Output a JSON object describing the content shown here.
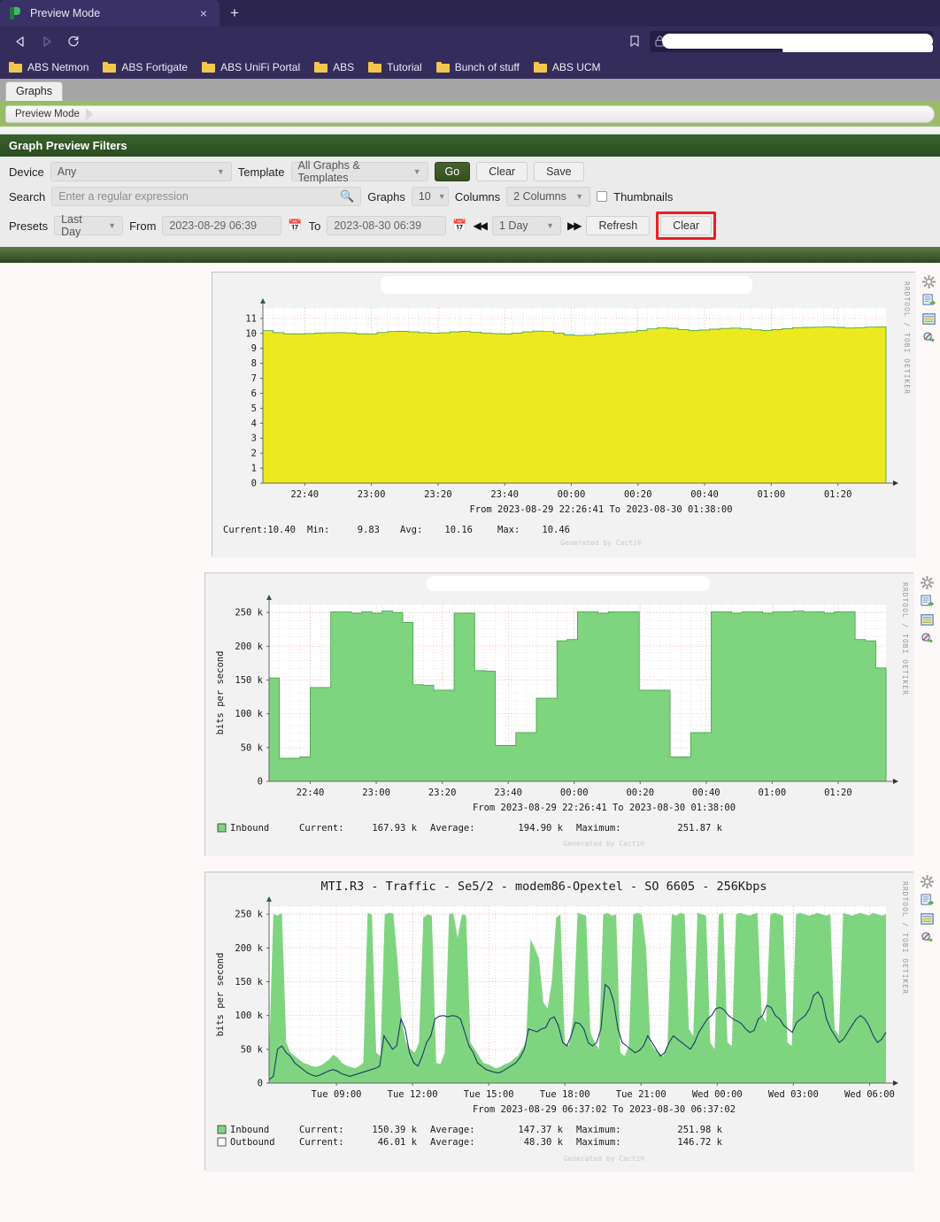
{
  "browser": {
    "tab": {
      "title": "Preview Mode",
      "close_label": "×",
      "favicon": "cacti-leaf-icon"
    },
    "newtab_label": "+",
    "nav": {
      "back": "back-arrow-icon",
      "forward": "forward-arrow-icon",
      "reload": "reload-icon"
    },
    "bookmark_star": "bookmark-outline-icon",
    "url_value": "",
    "bookmarks": [
      {
        "label": "ABS Netmon"
      },
      {
        "label": "ABS Fortigate"
      },
      {
        "label": "ABS UniFi Portal"
      },
      {
        "label": "ABS"
      },
      {
        "label": "Tutorial"
      },
      {
        "label": "Bunch of stuff"
      },
      {
        "label": "ABS UCM"
      }
    ]
  },
  "app": {
    "tab_label": "Graphs",
    "breadcrumb": "Preview Mode"
  },
  "filters": {
    "header": "Graph Preview Filters",
    "device_label": "Device",
    "device_value": "Any",
    "template_label": "Template",
    "template_value": "All Graphs & Templates",
    "go_label": "Go",
    "clear_label": "Clear",
    "save_label": "Save",
    "search_label": "Search",
    "search_placeholder": "Enter a regular expression",
    "search_value": "",
    "graphs_label": "Graphs",
    "graphs_value": "10",
    "columns_label": "Columns",
    "columns_value": "2 Columns",
    "thumbnails_label": "Thumbnails",
    "thumbnails_checked": false,
    "presets_label": "Presets",
    "presets_value": "Last Day",
    "from_label": "From",
    "from_value": "2023-08-29 06:39",
    "to_label": "To",
    "to_value": "2023-08-30 06:39",
    "step_value": "1 Day",
    "refresh_label": "Refresh",
    "clear2_label": "Clear",
    "highlight_color": "#ee1c25"
  },
  "icons": {
    "gear": "gear-icon",
    "csv_export": "csv-export-icon",
    "properties": "graph-properties-icon",
    "zoom_disabled": "zoom-disabled-icon",
    "watermark": "RRDTOOL / TOBI OETIKER"
  },
  "chart_data": [
    {
      "id": "graph-1",
      "type": "area",
      "title": "",
      "title_redacted": true,
      "ylabel": "",
      "xlabel": "",
      "ylim": [
        0,
        11.7
      ],
      "yticks": [
        0,
        1,
        2,
        3,
        4,
        5,
        6,
        7,
        8,
        9,
        10,
        11
      ],
      "ytick_labels": [
        "0",
        "1",
        "2",
        "3",
        "4",
        "5",
        "6",
        "7",
        "8",
        "9",
        "10",
        "11"
      ],
      "xticks": [
        "22:40",
        "23:00",
        "23:20",
        "23:40",
        "00:00",
        "00:20",
        "00:40",
        "01:00",
        "01:20"
      ],
      "grid": true,
      "series": [
        {
          "name": "",
          "color": "#ecea1f",
          "values": [
            10.18,
            10.05,
            9.97,
            9.96,
            9.98,
            10.02,
            10.04,
            10.05,
            10.03,
            9.97,
            9.95,
            10.06,
            10.12,
            10.14,
            10.1,
            10.05,
            10.02,
            10.04,
            10.1,
            10.14,
            10.08,
            10.02,
            9.98,
            9.96,
            10.02,
            10.1,
            10.15,
            10.12,
            10.02,
            9.9,
            9.86,
            9.88,
            9.95,
            10.0,
            10.05,
            10.1,
            10.2,
            10.3,
            10.38,
            10.34,
            10.26,
            10.2,
            10.22,
            10.28,
            10.33,
            10.35,
            10.3,
            10.24,
            10.2,
            10.26,
            10.32,
            10.38,
            10.4,
            10.42,
            10.44,
            10.4,
            10.36,
            10.38,
            10.42,
            10.44,
            10.4
          ]
        }
      ],
      "range_text": "From 2023-08-29 22:26:41 To 2023-08-30 01:38:00",
      "legend": [
        {
          "label": "Current:",
          "value": "10.40"
        },
        {
          "label": "Min:",
          "value": "9.83"
        },
        {
          "label": "Avg:",
          "value": "10.16"
        },
        {
          "label": "Max:",
          "value": "10.46"
        }
      ],
      "footer": "Generated by Cacti®"
    },
    {
      "id": "graph-2",
      "type": "area",
      "title": "",
      "title_redacted": true,
      "ylabel": "bits per second",
      "xlabel": "",
      "ylim": [
        0,
        262000
      ],
      "yticks": [
        0,
        50000,
        100000,
        150000,
        200000,
        250000
      ],
      "ytick_labels": [
        "0",
        "50 k",
        "100 k",
        "150 k",
        "200 k",
        "250 k"
      ],
      "xticks": [
        "22:40",
        "23:00",
        "23:20",
        "23:40",
        "00:00",
        "00:20",
        "00:40",
        "01:00",
        "01:20"
      ],
      "grid": true,
      "series": [
        {
          "name": "Inbound",
          "color": "#7fd47f",
          "values": [
            153000,
            34000,
            34000,
            36000,
            139000,
            139000,
            251000,
            251000,
            249000,
            251000,
            249000,
            252000,
            250000,
            235000,
            143000,
            142000,
            135000,
            135000,
            249000,
            249000,
            164000,
            163000,
            53000,
            53000,
            72000,
            72000,
            123000,
            123000,
            208000,
            210000,
            251000,
            251000,
            249000,
            251000,
            251000,
            251000,
            135000,
            135000,
            135000,
            36000,
            36000,
            72000,
            72000,
            251000,
            251000,
            249000,
            251000,
            251000,
            249000,
            251000,
            251000,
            252000,
            251000,
            251000,
            249000,
            251000,
            251000,
            210000,
            208000,
            168000,
            168000
          ]
        }
      ],
      "range_text": "From 2023-08-29 22:26:41 To 2023-08-30 01:38:00",
      "legend": [
        {
          "swatch": "#7fd47f",
          "name": "Inbound",
          "cur_label": "Current:",
          "cur": "167.93 k",
          "avg_label": "Average:",
          "avg": "194.90 k",
          "max_label": "Maximum:",
          "max": "251.87 k"
        }
      ],
      "footer": "Generated by Cacti®"
    },
    {
      "id": "graph-3",
      "type": "area",
      "title": "MTI.R3 - Traffic - Se5/2 - modem86-Opextel - SO 6605 - 256Kbps",
      "title_redacted": false,
      "ylabel": "bits per second",
      "xlabel": "",
      "ylim": [
        0,
        262000
      ],
      "yticks": [
        0,
        50000,
        100000,
        150000,
        200000,
        250000
      ],
      "ytick_labels": [
        "0",
        "50 k",
        "100 k",
        "150 k",
        "200 k",
        "250 k"
      ],
      "xticks": [
        "Tue 09:00",
        "Tue 12:00",
        "Tue 15:00",
        "Tue 18:00",
        "Tue 21:00",
        "Wed 00:00",
        "Wed 03:00",
        "Wed 06:00"
      ],
      "grid": true,
      "series": [
        {
          "name": "Inbound",
          "color": "#7fd47f",
          "kind": "area",
          "values": [
            40,
            250,
            248,
            252,
            60,
            45,
            40,
            35,
            30,
            28,
            25,
            24,
            26,
            30,
            35,
            42,
            38,
            30,
            26,
            24,
            22,
            25,
            30,
            252,
            250,
            45,
            40,
            250,
            252,
            251,
            180,
            90,
            60,
            50,
            45,
            60,
            245,
            250,
            248,
            30,
            28,
            45,
            250,
            252,
            215,
            250,
            248,
            60,
            50,
            40,
            30,
            28,
            25,
            22,
            24,
            28,
            30,
            35,
            40,
            50,
            60,
            213,
            200,
            185,
            120,
            110,
            150,
            245,
            250,
            60,
            55,
            100,
            252,
            250,
            248,
            75,
            60,
            50,
            250,
            252,
            248,
            250,
            45,
            40,
            55,
            250,
            252,
            250,
            200,
            60,
            50,
            45,
            40,
            55,
            250,
            248,
            252,
            250,
            80,
            70,
            252,
            250,
            248,
            60,
            50,
            250,
            252,
            60,
            55,
            250,
            252,
            250,
            248,
            250,
            252,
            100,
            90,
            250,
            252,
            250,
            248,
            60,
            55,
            250,
            252,
            250,
            248,
            250,
            252,
            250,
            248,
            250,
            80,
            70,
            252,
            250,
            248,
            250,
            252,
            250,
            248,
            252,
            250,
            248,
            250
          ]
        },
        {
          "name": "Outbound",
          "color": "#1f3a6b",
          "kind": "line",
          "values": [
            5,
            10,
            50,
            55,
            45,
            40,
            30,
            25,
            20,
            15,
            12,
            10,
            12,
            15,
            18,
            20,
            18,
            14,
            12,
            10,
            12,
            14,
            16,
            18,
            20,
            22,
            25,
            70,
            60,
            50,
            55,
            95,
            80,
            45,
            30,
            25,
            40,
            60,
            70,
            95,
            99,
            100,
            98,
            100,
            99,
            95,
            75,
            55,
            45,
            30,
            25,
            20,
            18,
            16,
            15,
            18,
            22,
            26,
            30,
            38,
            50,
            80,
            78,
            76,
            80,
            82,
            95,
            98,
            85,
            60,
            55,
            70,
            90,
            88,
            80,
            60,
            55,
            60,
            80,
            146,
            140,
            120,
            80,
            60,
            55,
            50,
            45,
            48,
            55,
            70,
            60,
            50,
            40,
            45,
            60,
            70,
            65,
            60,
            55,
            50,
            60,
            75,
            85,
            95,
            100,
            110,
            112,
            108,
            100,
            95,
            92,
            88,
            80,
            75,
            78,
            95,
            100,
            115,
            112,
            100,
            95,
            85,
            80,
            75,
            90,
            95,
            100,
            110,
            130,
            135,
            125,
            95,
            80,
            70,
            60,
            65,
            75,
            85,
            95,
            100,
            95,
            85,
            70,
            60,
            65,
            75
          ]
        }
      ],
      "range_text": "From 2023-08-29 06:37:02 To 2023-08-30 06:37:02",
      "legend": [
        {
          "swatch": "#7fd47f",
          "filled": true,
          "name": "Inbound",
          "cur_label": "Current:",
          "cur": "150.39 k",
          "avg_label": "Average:",
          "avg": "147.37 k",
          "max_label": "Maximum:",
          "max": "251.98 k"
        },
        {
          "swatch": "#ffffff",
          "filled": false,
          "name": "Outbound",
          "cur_label": "Current:",
          "cur": "46.01 k",
          "avg_label": "Average:",
          "avg": "48.30 k",
          "max_label": "Maximum:",
          "max": "146.72 k"
        }
      ],
      "footer": "Generated by Cacti®"
    }
  ]
}
